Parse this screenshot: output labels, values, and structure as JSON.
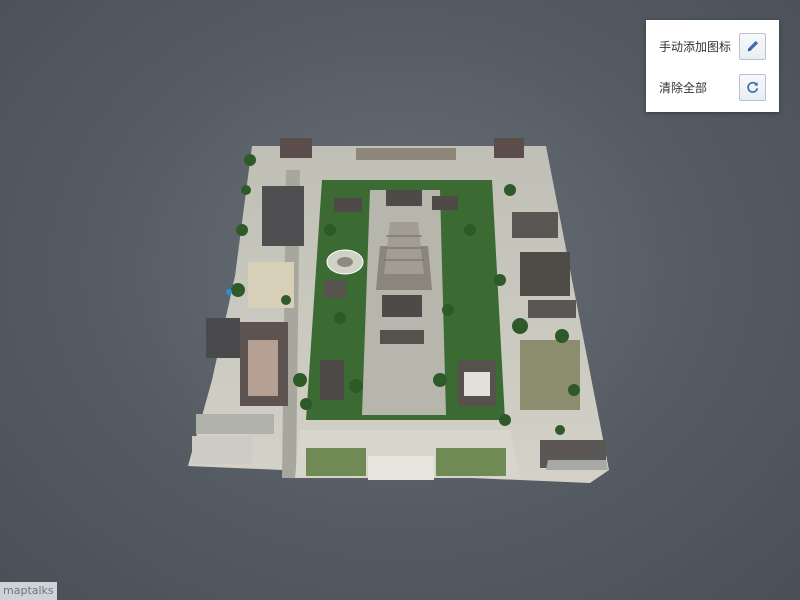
{
  "viewer": {
    "background_color": "#555b63",
    "model": {
      "ground_color": "#c9c8bd",
      "roof_color": "#4d4a47",
      "tree_color": "#2f5a2a"
    }
  },
  "toolbar": {
    "add_icon_label": "手动添加图标",
    "add_icon_button_icon": "pencil-icon",
    "clear_all_label": "清除全部",
    "clear_all_button_icon": "refresh-icon",
    "accent_color": "#3d6fb0"
  },
  "attribution": {
    "text": "maptalks"
  }
}
